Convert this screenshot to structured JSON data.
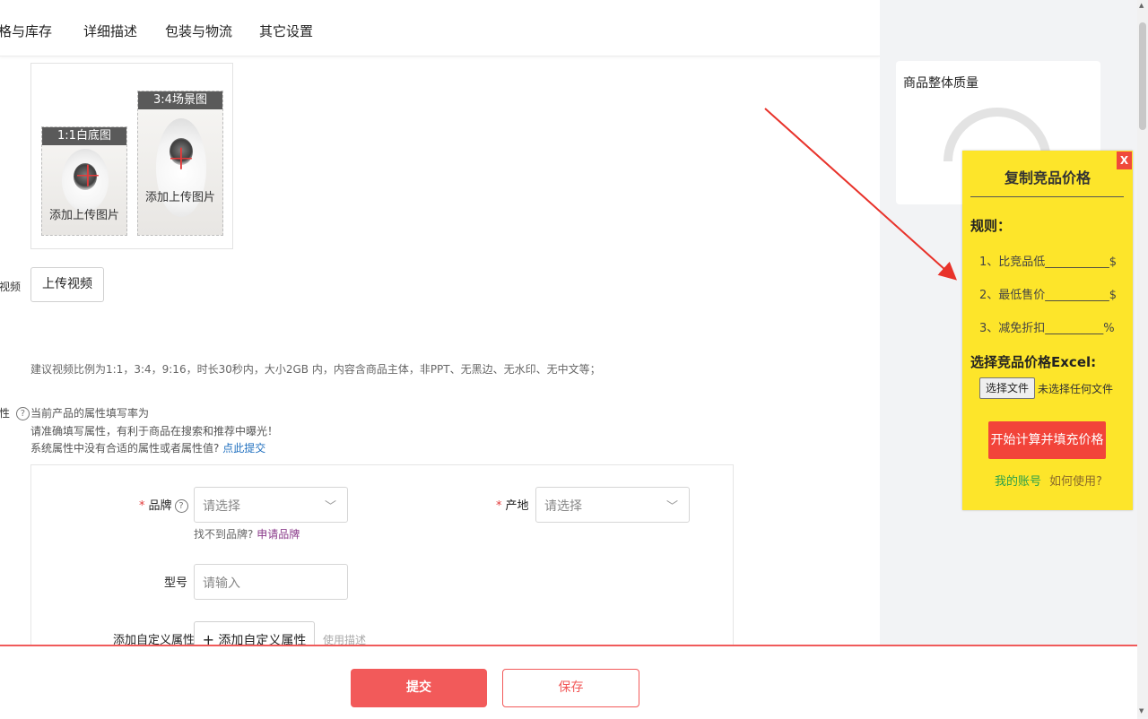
{
  "tabs": [
    "格与库存",
    "详细描述",
    "包装与物流",
    "其它设置"
  ],
  "images": {
    "card1": {
      "label": "1:1白底图",
      "text": "添加上传图片"
    },
    "card2": {
      "label": "3:4场景图",
      "text": "添加上传图片"
    }
  },
  "video": {
    "label": "视频",
    "button": "上传视频",
    "hint": "建议视频比例为1:1，3:4，9:16，时长30秒内，大小2GB 内，内容含商品主体，非PPT、无黑边、无水印、无中文等；"
  },
  "attributes": {
    "label": "性",
    "rate_text": "当前产品的属性填写率为",
    "tip1": "请准确填写属性，有利于商品在搜索和推荐中曝光！",
    "tip2": "系统属性中没有合适的属性或者属性值?",
    "tip2_link": "点此提交",
    "brand": {
      "label": "品牌",
      "required": "*",
      "placeholder": "请选择",
      "help": "找不到品牌?",
      "help_link": "申请品牌"
    },
    "origin": {
      "label": "产地",
      "required": "*",
      "placeholder": "请选择"
    },
    "model": {
      "label": "型号",
      "placeholder": "请输入"
    },
    "custom": {
      "label": "添加自定义属性",
      "button": "添加自定义属性",
      "desc": "使用描述"
    }
  },
  "footer": {
    "submit": "提交",
    "save": "保存"
  },
  "quality": {
    "title": "商品整体质量"
  },
  "plugin": {
    "close": "X",
    "title": "复制竞品价格",
    "rules_heading": "规则：",
    "rules": [
      "1、比竞品低___________$",
      "2、最低售价___________$",
      "3、减免折扣__________%"
    ],
    "excel_heading": "选择竞品价格Excel:",
    "file_button": "选择文件",
    "file_status": "未选择任何文件",
    "calc_button": "开始计算并填充价格",
    "link_account": "我的账号",
    "link_help": "如何使用?"
  },
  "colors": {
    "accent": "#f25a5a",
    "plugin_bg": "#fde52a",
    "link_blue": "#1f6fbf",
    "link_purple": "#8a3a8a"
  }
}
